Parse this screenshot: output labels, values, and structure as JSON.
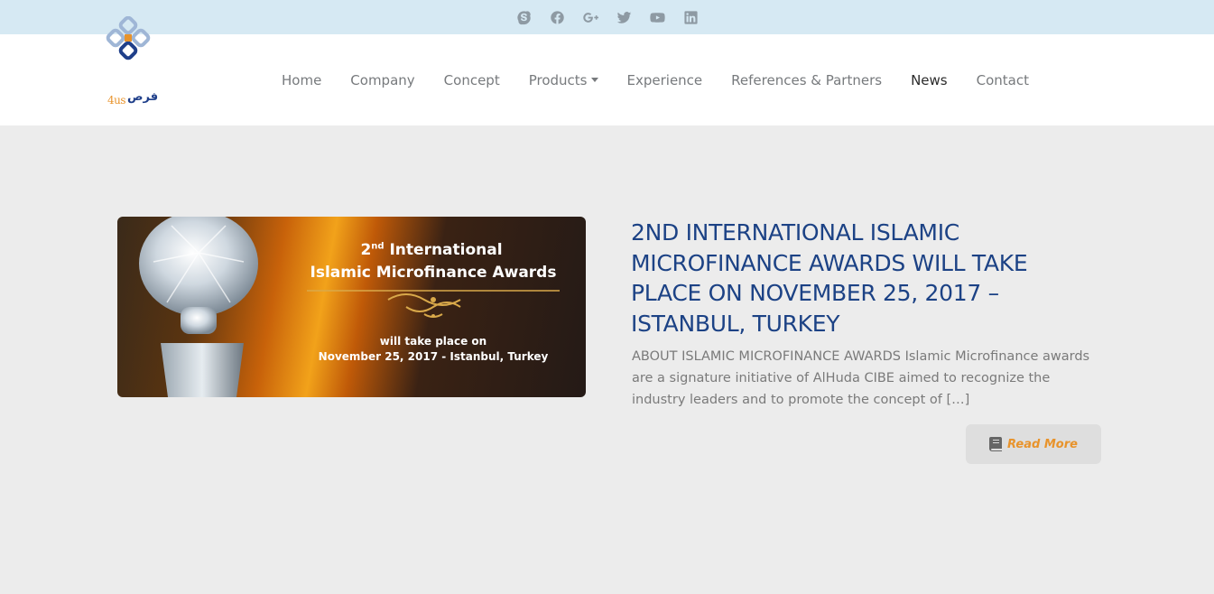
{
  "social": {
    "icons": [
      "skype-icon",
      "facebook-icon",
      "google-plus-icon",
      "twitter-icon",
      "youtube-icon",
      "linkedin-icon"
    ],
    "icon_color": "#8e9aa3",
    "bar_color": "#d6e9f3"
  },
  "brand": {
    "logo_latin": "4us",
    "logo_arabic": "فرص"
  },
  "nav": {
    "items": [
      {
        "label": "Home"
      },
      {
        "label": "Company"
      },
      {
        "label": "Concept"
      },
      {
        "label": "Products"
      },
      {
        "label": "Experience"
      },
      {
        "label": "References & Partners"
      },
      {
        "label": "News"
      },
      {
        "label": "Contact"
      }
    ],
    "active": "News"
  },
  "post": {
    "image": {
      "title_prefix": "2",
      "title_sup": "nd",
      "title_rest": " International",
      "title_line2": "Islamic Microfinance Awards",
      "sub_line1": "will take place on",
      "sub_line2": "November 25, 2017 - Istanbul, Turkey"
    },
    "title": "2nd International Islamic Microfinance Awards will take place on November 25, 2017 – Istanbul, Turkey",
    "excerpt": "ABOUT ISLAMIC MICROFINANCE AWARDS Islamic Microfinance awards are a signature initiative of AlHuda CIBE aimed to recognize the industry leaders and to promote the concept of […]",
    "read_more": "Read More"
  },
  "colors": {
    "title": "#1c4285",
    "accent": "#e8932b",
    "background": "#ececec"
  }
}
